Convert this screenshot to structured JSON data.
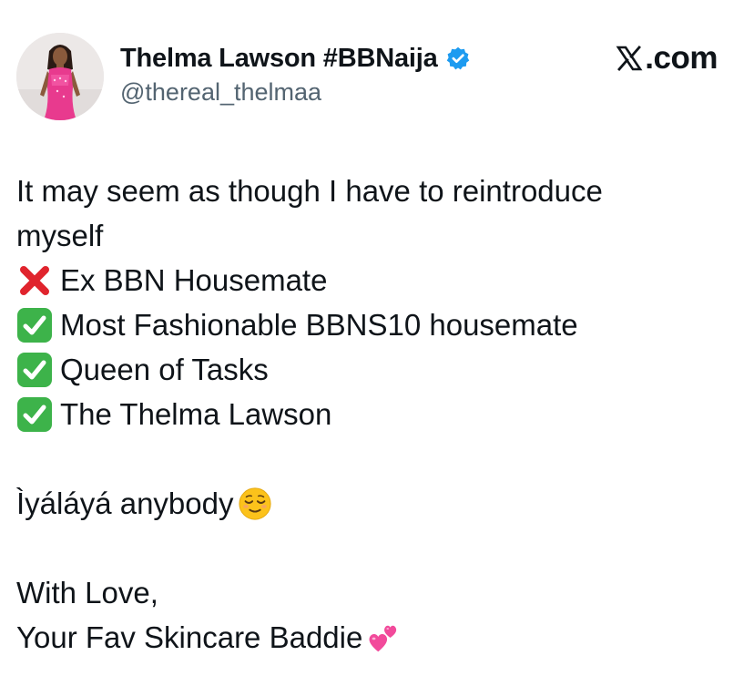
{
  "author": {
    "display_name": "Thelma Lawson #BBNaija",
    "handle": "@thereal_thelmaa",
    "verified": true,
    "verified_color": "#1d9bf0"
  },
  "brand": {
    "logo_text": ".com",
    "icon": "x-logo-icon"
  },
  "tweet": {
    "lines": [
      {
        "text": "It may seem as though I have to reintroduce"
      },
      {
        "text": "myself"
      },
      {
        "icon": "red-cross-mark-icon",
        "text": "Ex BBN Housemate"
      },
      {
        "icon": "green-check-mark-icon",
        "text": "Most Fashionable BBNS10 housemate"
      },
      {
        "icon": "green-check-mark-icon",
        "text": "Queen of Tasks"
      },
      {
        "icon": "green-check-mark-icon",
        "text": "The Thelma Lawson"
      },
      {
        "text": ""
      },
      {
        "text": "Ìyáláyá anybody",
        "trailing_icon": "relieved-face-icon"
      },
      {
        "text": ""
      },
      {
        "text": "With Love,"
      },
      {
        "text": "Your Fav Skincare Baddie",
        "trailing_icon": "two-hearts-icon"
      }
    ]
  },
  "colors": {
    "text_primary": "#0f1419",
    "text_secondary": "#536471",
    "cross_red": "#e0242d",
    "check_green": "#3db34a",
    "heart_pink": "#f24a9b"
  }
}
